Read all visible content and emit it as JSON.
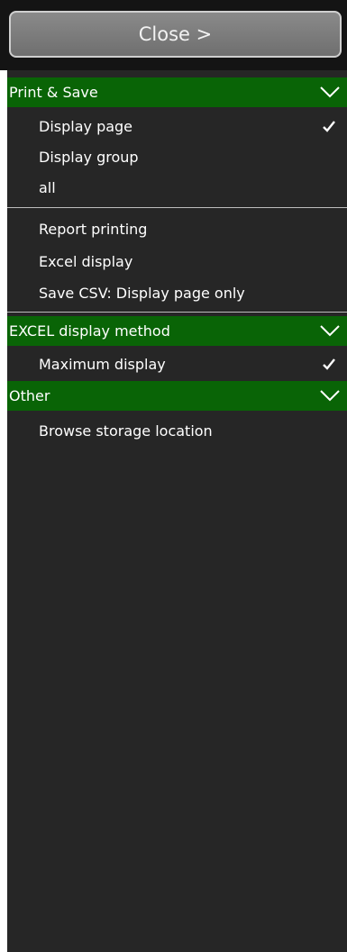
{
  "close_button": {
    "label": "Close >"
  },
  "sections": [
    {
      "title": "Print & Save",
      "items": [
        {
          "label": "Display page",
          "checked": true
        },
        {
          "label": "Display group",
          "checked": false
        },
        {
          "label": "all",
          "checked": false
        },
        {
          "label": "Report printing",
          "checked": false
        },
        {
          "label": "Excel display",
          "checked": false
        },
        {
          "label": "Save CSV: Display page only",
          "checked": false
        }
      ]
    },
    {
      "title": "EXCEL display method",
      "items": [
        {
          "label": "Maximum display",
          "checked": true
        }
      ]
    },
    {
      "title": "Other",
      "items": [
        {
          "label": "Browse storage location",
          "checked": false
        }
      ]
    }
  ],
  "colors": {
    "header_green": "#096406",
    "panel_bg": "#262626",
    "close_button_bg": "#7c7c7c"
  }
}
